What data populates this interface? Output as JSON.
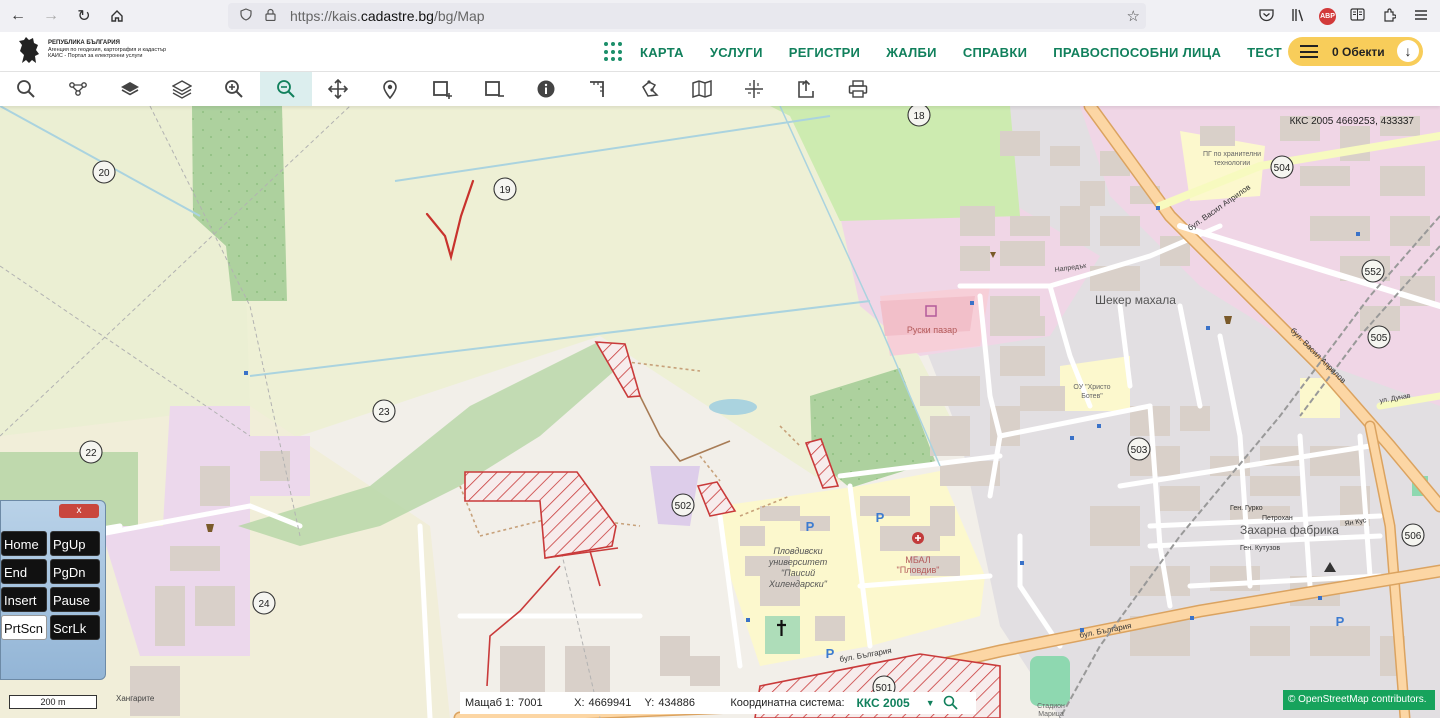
{
  "browser": {
    "url_prefix": "https://kais.",
    "url_domain": "cadastre.bg",
    "url_path": "/bg/Map",
    "abp_label": "ABP"
  },
  "site": {
    "logo_line1": "РЕПУБЛИКА БЪЛГАРИЯ",
    "logo_line2": "Агенция по геодезия, картография и кадастър",
    "logo_line3": "КАИС - Портал за електронни услуги",
    "menu": [
      "КАРТА",
      "УСЛУГИ",
      "РЕГИСТРИ",
      "ЖАЛБИ",
      "СПРАВКИ",
      "ПРАВОСПОСОБНИ ЛИЦА",
      "ТЕСТ"
    ],
    "objects_button": "0 Обекти"
  },
  "toolbar": {
    "tools": [
      "search-icon",
      "layer-tree-icon",
      "layers-stack-icon",
      "layers-icon",
      "zoom-in-icon",
      "zoom-out-icon",
      "pan-icon",
      "marker-icon",
      "select-rectangle-add-icon",
      "select-rectangle-remove-icon",
      "info-icon",
      "measure-distance-icon",
      "measure-area-icon",
      "map-icon",
      "coordinates-icon",
      "export-icon",
      "print-icon"
    ],
    "active_tool": "zoom-out-icon",
    "accent": "#11805c"
  },
  "map": {
    "top_right_coords": "ККС 2005 4669253, 433337",
    "road_numbers": [
      "18",
      "19",
      "20",
      "22",
      "23",
      "24",
      "502",
      "503",
      "504",
      "505",
      "506",
      "552",
      "501"
    ],
    "labels": {
      "sheker": "Шекер махала",
      "zaharna": "Захарна фабрика",
      "ruski_pazar": "Руски пазар",
      "university_1": "Пловдивски",
      "university_2": "университет",
      "university_3": "\"Паисий",
      "university_4": "Хилендарски\"",
      "hospital_1": "МБАЛ",
      "hospital_2": "\"Пловдив\"",
      "school_1": "ПГ по хранителни",
      "school_2": "технологии",
      "ou_1": "ОУ \"Христо",
      "ou_2": "Ботев\"",
      "stadium_1": "Стадион",
      "stadium_2": "Марица",
      "hangarite": "Хангарите",
      "napreduk": "Напредък",
      "blvd_bulgaria": "бул. България",
      "blvd_vasil": "бул. Васил Априлов",
      "gen_gurko": "Ген. Гурко",
      "gen_kutuzov": "Ген. Кутузов",
      "petrohan": "Петрохан",
      "danov": "ул. Дунав",
      "yan_kus": "Ян Кус",
      "parking": "P"
    }
  },
  "osk": {
    "close": "x",
    "keys": [
      "Home",
      "PgUp",
      "End",
      "PgDn",
      "Insert",
      "Pause",
      "PrtScn",
      "ScrLk"
    ],
    "highlighted": "PrtScn"
  },
  "scale": "200 m",
  "status": {
    "scale_label": "Мащаб 1:",
    "scale_value": "7001",
    "x_label": "X:",
    "x_value": "4669941",
    "y_label": "Y:",
    "y_value": "434886",
    "crs_label": "Координатна система:",
    "crs_value": "ККС 2005"
  },
  "attribution": "© OpenStreetMap contributors."
}
